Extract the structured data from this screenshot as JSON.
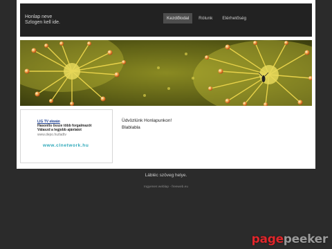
{
  "header": {
    "site_name_line1": "Honlap neve",
    "site_name_line2": "Szlogen kell ide."
  },
  "nav": {
    "items": [
      {
        "label": "Kezdőlodal",
        "active": true
      },
      {
        "label": "Rólunk",
        "active": false
      },
      {
        "label": "Elérhetőség",
        "active": false
      }
    ]
  },
  "banner": {
    "subject": "sundew plant close-up photo"
  },
  "sidebar": {
    "ad": {
      "title": "LIG TV ekwán",
      "line1": "Hasonlts össze több forgalmazót",
      "line2": "Válaszd a legjobb ajánlatot",
      "url": "www.depo.hu/ladtv",
      "network": "www.clnetwork.hu"
    }
  },
  "content": {
    "welcome": "Üdvözlünk Honlapunkon!",
    "body": "Blablabla"
  },
  "footer": {
    "text": "Lábléc szöveg helye.",
    "credit": "Ingyenes weblap - freeweb.eu"
  },
  "watermark": {
    "part1": "page",
    "part2": "peeker"
  },
  "colors": {
    "background": "#2b2b2b",
    "header": "#222222",
    "nav_active": "#4d4d4d",
    "ad_network": "#2aa7b8",
    "watermark_red": "#e0262b"
  }
}
